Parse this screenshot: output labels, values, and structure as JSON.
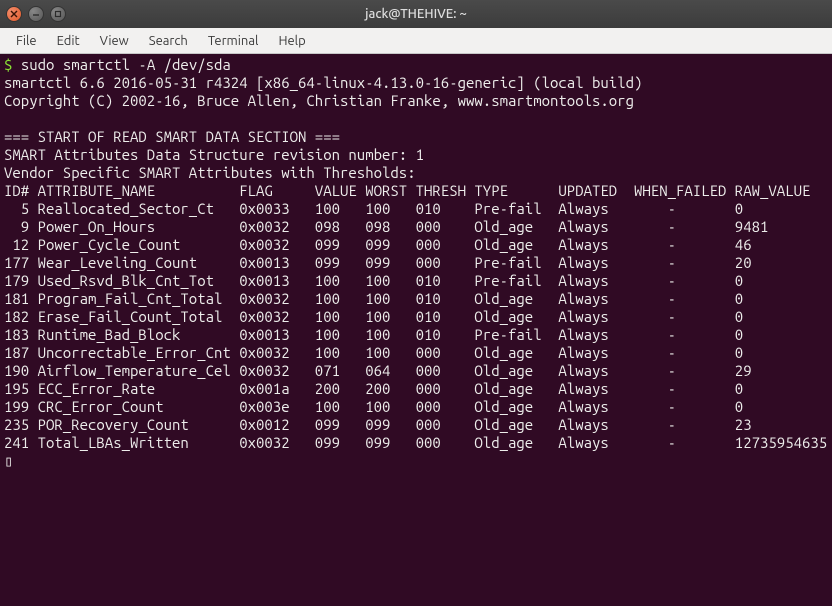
{
  "window": {
    "title": "jack@THEHIVE: ~"
  },
  "menu": {
    "file": "File",
    "edit": "Edit",
    "view": "View",
    "search": "Search",
    "terminal": "Terminal",
    "help": "Help"
  },
  "prompt": {
    "symbol": "$",
    "command": "sudo smartctl -A /dev/sda"
  },
  "output": {
    "line1": "smartctl 6.6 2016-05-31 r4324 [x86_64-linux-4.13.0-16-generic] (local build)",
    "line2": "Copyright (C) 2002-16, Bruce Allen, Christian Franke, www.smartmontools.org",
    "blank1": "",
    "section": "=== START OF READ SMART DATA SECTION ===",
    "rev": "SMART Attributes Data Structure revision number: 1",
    "vendor": "Vendor Specific SMART Attributes with Thresholds:",
    "header": "ID# ATTRIBUTE_NAME          FLAG     VALUE WORST THRESH TYPE      UPDATED  WHEN_FAILED RAW_VALUE",
    "row5": "  5 Reallocated_Sector_Ct   0x0033   100   100   010    Pre-fail  Always       -       0",
    "row9": "  9 Power_On_Hours          0x0032   098   098   000    Old_age   Always       -       9481",
    "row12": " 12 Power_Cycle_Count       0x0032   099   099   000    Old_age   Always       -       46",
    "row177": "177 Wear_Leveling_Count     0x0013   099   099   000    Pre-fail  Always       -       20",
    "row179": "179 Used_Rsvd_Blk_Cnt_Tot   0x0013   100   100   010    Pre-fail  Always       -       0",
    "row181": "181 Program_Fail_Cnt_Total  0x0032   100   100   010    Old_age   Always       -       0",
    "row182": "182 Erase_Fail_Count_Total  0x0032   100   100   010    Old_age   Always       -       0",
    "row183": "183 Runtime_Bad_Block       0x0013   100   100   010    Pre-fail  Always       -       0",
    "row187": "187 Uncorrectable_Error_Cnt 0x0032   100   100   000    Old_age   Always       -       0",
    "row190": "190 Airflow_Temperature_Cel 0x0032   071   064   000    Old_age   Always       -       29",
    "row195": "195 ECC_Error_Rate          0x001a   200   200   000    Old_age   Always       -       0",
    "row199": "199 CRC_Error_Count         0x003e   100   100   000    Old_age   Always       -       0",
    "row235": "235 POR_Recovery_Count      0x0012   099   099   000    Old_age   Always       -       23",
    "row241": "241 Total_LBAs_Written      0x0032   099   099   000    Old_age   Always       -       12735954635"
  },
  "chart_data": {
    "type": "table",
    "title": "SMART Attributes",
    "columns": [
      "ID#",
      "ATTRIBUTE_NAME",
      "FLAG",
      "VALUE",
      "WORST",
      "THRESH",
      "TYPE",
      "UPDATED",
      "WHEN_FAILED",
      "RAW_VALUE"
    ],
    "rows": [
      [
        5,
        "Reallocated_Sector_Ct",
        "0x0033",
        100,
        100,
        10,
        "Pre-fail",
        "Always",
        "-",
        0
      ],
      [
        9,
        "Power_On_Hours",
        "0x0032",
        98,
        98,
        0,
        "Old_age",
        "Always",
        "-",
        9481
      ],
      [
        12,
        "Power_Cycle_Count",
        "0x0032",
        99,
        99,
        0,
        "Old_age",
        "Always",
        "-",
        46
      ],
      [
        177,
        "Wear_Leveling_Count",
        "0x0013",
        99,
        99,
        0,
        "Pre-fail",
        "Always",
        "-",
        20
      ],
      [
        179,
        "Used_Rsvd_Blk_Cnt_Tot",
        "0x0013",
        100,
        100,
        10,
        "Pre-fail",
        "Always",
        "-",
        0
      ],
      [
        181,
        "Program_Fail_Cnt_Total",
        "0x0032",
        100,
        100,
        10,
        "Old_age",
        "Always",
        "-",
        0
      ],
      [
        182,
        "Erase_Fail_Count_Total",
        "0x0032",
        100,
        100,
        10,
        "Old_age",
        "Always",
        "-",
        0
      ],
      [
        183,
        "Runtime_Bad_Block",
        "0x0013",
        100,
        100,
        10,
        "Pre-fail",
        "Always",
        "-",
        0
      ],
      [
        187,
        "Uncorrectable_Error_Cnt",
        "0x0032",
        100,
        100,
        0,
        "Old_age",
        "Always",
        "-",
        0
      ],
      [
        190,
        "Airflow_Temperature_Cel",
        "0x0032",
        71,
        64,
        0,
        "Old_age",
        "Always",
        "-",
        29
      ],
      [
        195,
        "ECC_Error_Rate",
        "0x001a",
        200,
        200,
        0,
        "Old_age",
        "Always",
        "-",
        0
      ],
      [
        199,
        "CRC_Error_Count",
        "0x003e",
        100,
        100,
        0,
        "Old_age",
        "Always",
        "-",
        0
      ],
      [
        235,
        "POR_Recovery_Count",
        "0x0012",
        99,
        99,
        0,
        "Old_age",
        "Always",
        "-",
        23
      ],
      [
        241,
        "Total_LBAs_Written",
        "0x0032",
        99,
        99,
        0,
        "Old_age",
        "Always",
        "-",
        12735954635
      ]
    ]
  }
}
